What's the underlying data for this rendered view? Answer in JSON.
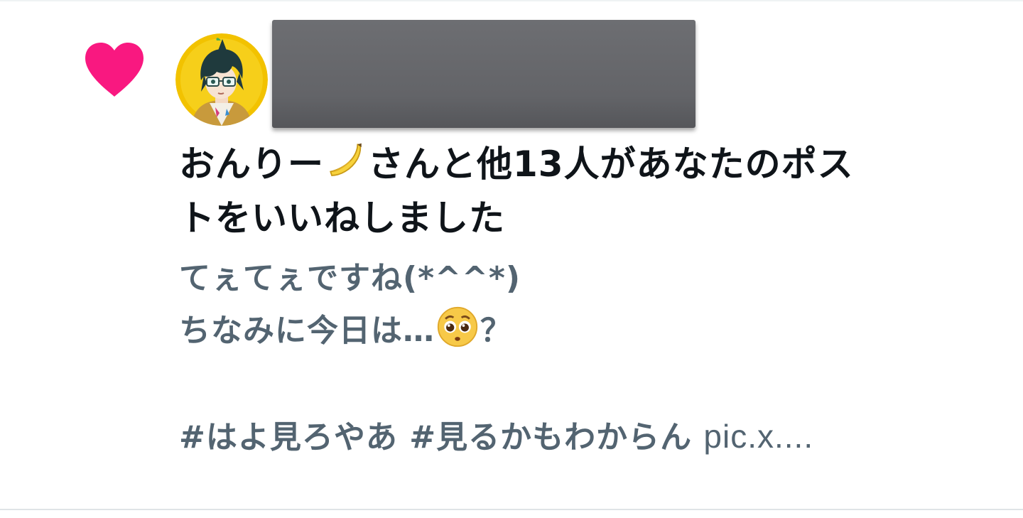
{
  "notification": {
    "icon": "heart-icon",
    "icon_color": "#f91880",
    "avatar": "user-avatar",
    "headline_user": "おんりー",
    "headline_user_emoji": "banana-emoji",
    "headline_rest_line1": "さんと他13人があなたのポス",
    "headline_rest_line2": "トをいいねしました",
    "post": {
      "line1": "てぇてぇですね(*^^*)",
      "line2_text": "ちなみに今日は…",
      "line2_emoji": "pleading-face-emoji",
      "line2_suffix": "？",
      "hashtag1": "#はよ見ろやあ",
      "hashtag2": "#見るかもわからん",
      "link": "pic.x...."
    }
  },
  "colors": {
    "headline": "#0f1419",
    "secondary_text": "#536471",
    "like": "#f91880",
    "divider": "#eff3f4"
  }
}
